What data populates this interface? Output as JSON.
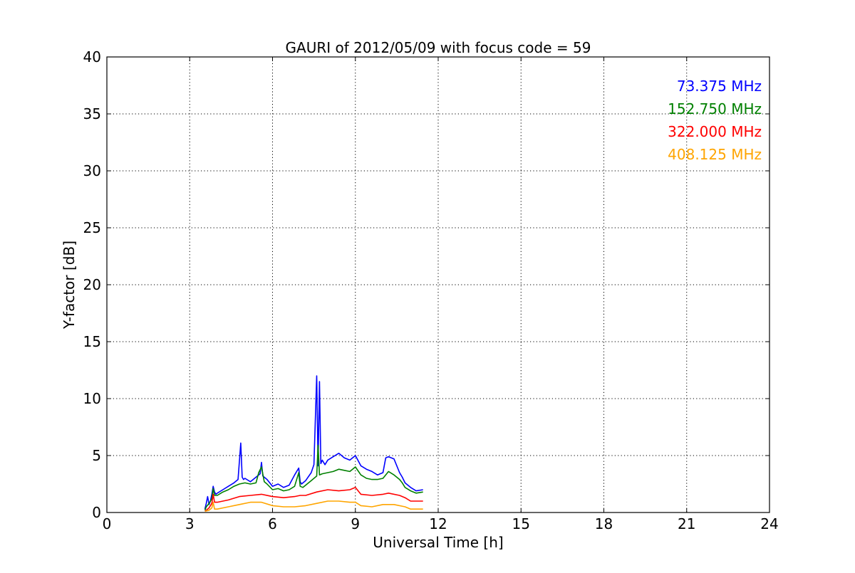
{
  "chart_data": {
    "type": "line",
    "title": "GAURI of 2012/05/09 with focus code = 59",
    "xlabel": "Universal Time [h]",
    "ylabel": "Y-factor [dB]",
    "xlim": [
      0,
      24
    ],
    "ylim": [
      0,
      40
    ],
    "xticks": [
      0,
      3,
      6,
      9,
      12,
      15,
      18,
      21,
      24
    ],
    "xtick_labels": [
      "0",
      "3",
      "6",
      "9",
      "12",
      "15",
      "18",
      "21",
      "24"
    ],
    "yticks": [
      0,
      5,
      10,
      15,
      20,
      25,
      30,
      35,
      40
    ],
    "ytick_labels": [
      "0",
      "5",
      "10",
      "15",
      "20",
      "25",
      "30",
      "35",
      "40"
    ],
    "grid": true,
    "legend_position": "top-right",
    "series": [
      {
        "name": "73.375 MHz",
        "color": "#0000ff",
        "x": [
          3.55,
          3.6,
          3.65,
          3.7,
          3.75,
          3.8,
          3.85,
          3.9,
          3.95,
          4.0,
          4.2,
          4.4,
          4.6,
          4.75,
          4.85,
          4.9,
          4.95,
          5.0,
          5.2,
          5.4,
          5.55,
          5.6,
          5.65,
          5.8,
          6.0,
          6.2,
          6.4,
          6.6,
          6.8,
          6.95,
          7.0,
          7.05,
          7.2,
          7.4,
          7.5,
          7.6,
          7.65,
          7.7,
          7.75,
          7.8,
          7.85,
          7.9,
          8.0,
          8.2,
          8.4,
          8.6,
          8.8,
          9.0,
          9.2,
          9.4,
          9.6,
          9.8,
          10.0,
          10.1,
          10.2,
          10.4,
          10.6,
          10.7,
          10.8,
          11.0,
          11.2,
          11.45
        ],
        "y": [
          0.3,
          0.8,
          1.4,
          0.7,
          1.0,
          1.6,
          2.3,
          1.8,
          1.6,
          1.7,
          2.0,
          2.3,
          2.6,
          2.9,
          6.1,
          3.1,
          2.9,
          3.0,
          2.7,
          3.1,
          3.4,
          4.4,
          3.2,
          2.9,
          2.3,
          2.5,
          2.2,
          2.4,
          3.3,
          3.9,
          2.7,
          2.5,
          2.8,
          3.5,
          4.2,
          12.0,
          4.1,
          11.5,
          4.3,
          4.6,
          4.4,
          4.2,
          4.6,
          4.9,
          5.2,
          4.8,
          4.6,
          5.0,
          4.1,
          3.8,
          3.6,
          3.3,
          3.5,
          4.8,
          4.9,
          4.7,
          3.5,
          3.1,
          2.6,
          2.2,
          1.9,
          2.0
        ]
      },
      {
        "name": "152.750 MHz",
        "color": "#008000",
        "x": [
          3.55,
          3.6,
          3.7,
          3.8,
          3.85,
          3.9,
          4.0,
          4.2,
          4.4,
          4.6,
          4.8,
          5.0,
          5.2,
          5.4,
          5.5,
          5.6,
          5.7,
          5.8,
          6.0,
          6.2,
          6.4,
          6.6,
          6.8,
          6.95,
          7.0,
          7.1,
          7.2,
          7.4,
          7.6,
          7.65,
          7.7,
          7.8,
          8.0,
          8.2,
          8.4,
          8.6,
          8.8,
          9.0,
          9.2,
          9.4,
          9.6,
          9.8,
          10.0,
          10.2,
          10.4,
          10.6,
          10.7,
          10.8,
          11.0,
          11.2,
          11.45
        ],
        "y": [
          0.2,
          0.5,
          0.8,
          1.2,
          2.1,
          1.5,
          1.5,
          1.8,
          2.0,
          2.3,
          2.5,
          2.6,
          2.5,
          2.6,
          3.5,
          4.0,
          2.7,
          2.5,
          2.0,
          2.1,
          1.9,
          2.0,
          2.3,
          3.5,
          2.3,
          2.2,
          2.4,
          2.8,
          3.2,
          5.9,
          3.3,
          3.4,
          3.5,
          3.6,
          3.8,
          3.7,
          3.6,
          4.0,
          3.3,
          3.0,
          2.9,
          2.9,
          3.0,
          3.6,
          3.3,
          2.9,
          2.6,
          2.2,
          1.9,
          1.7,
          1.8
        ]
      },
      {
        "name": "322.000 MHz",
        "color": "#ff0000",
        "x": [
          3.55,
          3.7,
          3.8,
          3.85,
          3.9,
          4.0,
          4.4,
          4.8,
          5.2,
          5.6,
          6.0,
          6.4,
          6.8,
          7.0,
          7.2,
          7.6,
          8.0,
          8.4,
          8.8,
          9.0,
          9.2,
          9.6,
          10.0,
          10.2,
          10.6,
          10.8,
          11.0,
          11.45
        ],
        "y": [
          0.1,
          0.4,
          0.8,
          1.6,
          0.9,
          0.9,
          1.1,
          1.4,
          1.5,
          1.6,
          1.4,
          1.3,
          1.4,
          1.5,
          1.5,
          1.8,
          2.0,
          1.9,
          2.0,
          2.2,
          1.6,
          1.5,
          1.6,
          1.7,
          1.5,
          1.3,
          1.0,
          1.0
        ]
      },
      {
        "name": "408.125 MHz",
        "color": "#ffa500",
        "x": [
          3.55,
          3.7,
          3.8,
          3.85,
          3.9,
          4.0,
          4.4,
          4.8,
          5.2,
          5.6,
          6.0,
          6.4,
          6.8,
          7.2,
          7.6,
          8.0,
          8.4,
          8.8,
          9.0,
          9.2,
          9.6,
          10.0,
          10.4,
          10.8,
          11.0,
          11.2,
          11.45
        ],
        "y": [
          0.1,
          0.2,
          0.4,
          0.9,
          0.3,
          0.3,
          0.5,
          0.7,
          0.9,
          0.9,
          0.6,
          0.5,
          0.5,
          0.6,
          0.8,
          1.0,
          1.0,
          0.9,
          0.9,
          0.6,
          0.5,
          0.7,
          0.7,
          0.5,
          0.3,
          0.3,
          0.3
        ]
      }
    ]
  }
}
